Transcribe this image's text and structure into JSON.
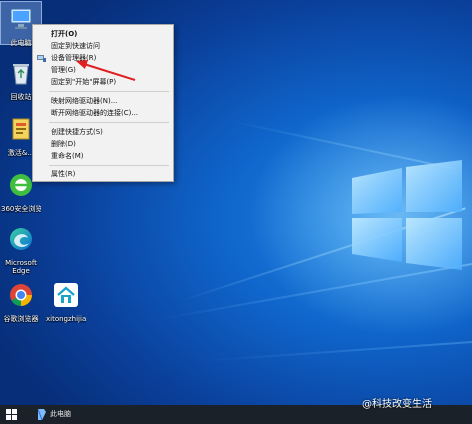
{
  "desktop_icons": [
    {
      "name": "this-pc",
      "label": "此电脑"
    },
    {
      "name": "recycle-bin",
      "label": "回收站"
    },
    {
      "name": "app-1",
      "label": "激活&..."
    },
    {
      "name": "360-browser",
      "label": "360安全浏览"
    },
    {
      "name": "microsoft-edge",
      "label": "Microsoft Edge"
    },
    {
      "name": "google-chrome",
      "label": "谷歌浏览器"
    },
    {
      "name": "xitong-app",
      "label": "xitongzhijia"
    }
  ],
  "context_menu": {
    "items": [
      {
        "label": "打开(O)",
        "bold": true
      },
      {
        "label": "固定到快速访问",
        "bold": false
      },
      {
        "label": "设备管理器(R)",
        "bold": false
      },
      {
        "label": "管理(G)",
        "bold": false
      },
      {
        "label": "固定到\"开始\"屏幕(P)",
        "bold": false
      },
      {
        "label": "映射网络驱动器(N)...",
        "bold": false
      },
      {
        "label": "断开网络驱动器的连接(C)...",
        "bold": false
      },
      {
        "label": "创建快捷方式(S)",
        "bold": false
      },
      {
        "label": "删除(D)",
        "bold": false
      },
      {
        "label": "重命名(M)",
        "bold": false
      },
      {
        "label": "属性(R)",
        "bold": false
      }
    ]
  },
  "taskbar": {
    "search_label": "此电脑",
    "start_icon": "windows-logo"
  },
  "watermark": {
    "text": "@科技改变生活"
  },
  "colors": {
    "arrow": "#e02020",
    "taskbar": "#1a2128",
    "menu_bg": "#f2f2f2"
  }
}
